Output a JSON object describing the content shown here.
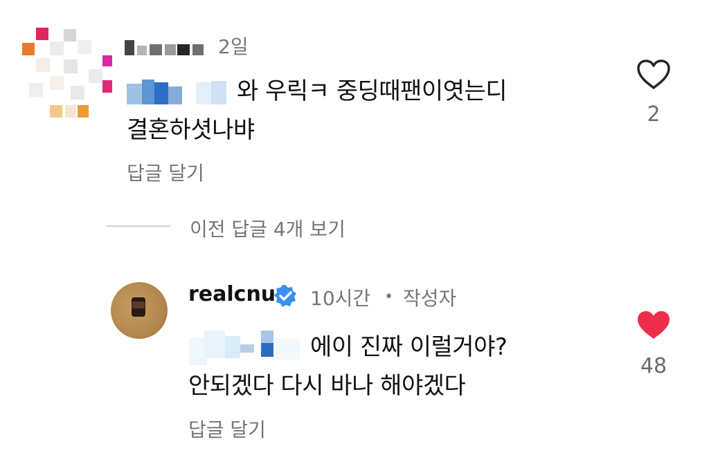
{
  "comments": [
    {
      "time": "2일",
      "text_line1": "와 우릭ㅋ 중딩때팬이엿는디",
      "text_line2": "결혼하셧나뱌",
      "reply_label": "답글 달기",
      "likes": "2",
      "liked": false
    }
  ],
  "view_previous_replies": "이전 답글 4개 보기",
  "reply": {
    "username": "realcnu",
    "verified": true,
    "time": "10시간",
    "separator": "•",
    "author_badge": "작성자",
    "text_line1": "에이 진짜 이럴거야?",
    "text_line2": "안되겠다 다시 바나 해야겠다",
    "reply_label": "답글 달기",
    "likes": "48",
    "liked": true
  },
  "colors": {
    "like_active": "#ed2e4a",
    "verified": "#3a8ff0",
    "meta_text": "#757575"
  },
  "icons": {
    "like_outline": "heart-outline-icon",
    "like_filled": "heart-filled-icon",
    "verified": "verified-badge-icon"
  }
}
